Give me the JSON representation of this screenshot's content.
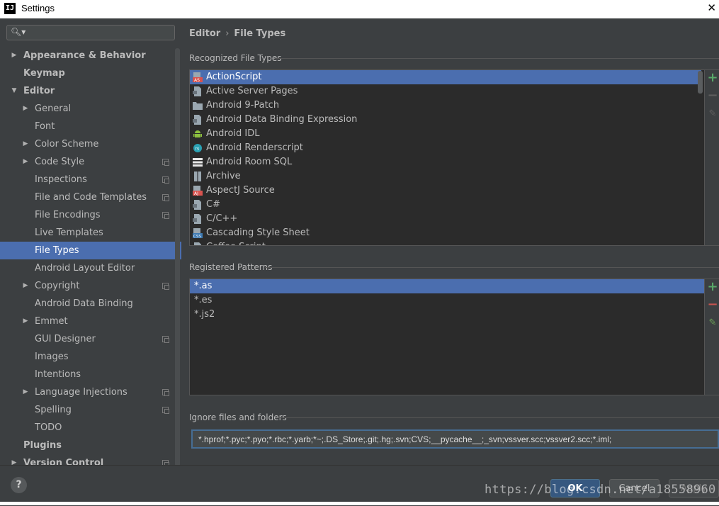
{
  "window": {
    "title": "Settings",
    "app_icon": "IJ"
  },
  "search": {
    "placeholder": "",
    "value": ""
  },
  "sidebar": {
    "items": [
      {
        "label": "Appearance & Behavior",
        "level": 0,
        "arrow": "right",
        "bold": true,
        "project": false,
        "selected": false
      },
      {
        "label": "Keymap",
        "level": 0,
        "arrow": "none",
        "bold": true,
        "project": false,
        "selected": false
      },
      {
        "label": "Editor",
        "level": 0,
        "arrow": "down",
        "bold": true,
        "project": false,
        "selected": false
      },
      {
        "label": "General",
        "level": 1,
        "arrow": "right",
        "bold": false,
        "project": false,
        "selected": false
      },
      {
        "label": "Font",
        "level": 1,
        "arrow": "none",
        "bold": false,
        "project": false,
        "selected": false
      },
      {
        "label": "Color Scheme",
        "level": 1,
        "arrow": "right",
        "bold": false,
        "project": false,
        "selected": false
      },
      {
        "label": "Code Style",
        "level": 1,
        "arrow": "right",
        "bold": false,
        "project": true,
        "selected": false
      },
      {
        "label": "Inspections",
        "level": 1,
        "arrow": "none",
        "bold": false,
        "project": true,
        "selected": false
      },
      {
        "label": "File and Code Templates",
        "level": 1,
        "arrow": "none",
        "bold": false,
        "project": true,
        "selected": false
      },
      {
        "label": "File Encodings",
        "level": 1,
        "arrow": "none",
        "bold": false,
        "project": true,
        "selected": false
      },
      {
        "label": "Live Templates",
        "level": 1,
        "arrow": "none",
        "bold": false,
        "project": false,
        "selected": false
      },
      {
        "label": "File Types",
        "level": 1,
        "arrow": "none",
        "bold": false,
        "project": false,
        "selected": true
      },
      {
        "label": "Android Layout Editor",
        "level": 1,
        "arrow": "none",
        "bold": false,
        "project": false,
        "selected": false
      },
      {
        "label": "Copyright",
        "level": 1,
        "arrow": "right",
        "bold": false,
        "project": true,
        "selected": false
      },
      {
        "label": "Android Data Binding",
        "level": 1,
        "arrow": "none",
        "bold": false,
        "project": false,
        "selected": false
      },
      {
        "label": "Emmet",
        "level": 1,
        "arrow": "right",
        "bold": false,
        "project": false,
        "selected": false
      },
      {
        "label": "GUI Designer",
        "level": 1,
        "arrow": "none",
        "bold": false,
        "project": true,
        "selected": false
      },
      {
        "label": "Images",
        "level": 1,
        "arrow": "none",
        "bold": false,
        "project": false,
        "selected": false
      },
      {
        "label": "Intentions",
        "level": 1,
        "arrow": "none",
        "bold": false,
        "project": false,
        "selected": false
      },
      {
        "label": "Language Injections",
        "level": 1,
        "arrow": "right",
        "bold": false,
        "project": true,
        "selected": false
      },
      {
        "label": "Spelling",
        "level": 1,
        "arrow": "none",
        "bold": false,
        "project": true,
        "selected": false
      },
      {
        "label": "TODO",
        "level": 1,
        "arrow": "none",
        "bold": false,
        "project": false,
        "selected": false
      },
      {
        "label": "Plugins",
        "level": 0,
        "arrow": "none",
        "bold": true,
        "project": false,
        "selected": false
      },
      {
        "label": "Version Control",
        "level": 0,
        "arrow": "right",
        "bold": true,
        "project": true,
        "selected": false
      }
    ]
  },
  "breadcrumb": {
    "parent": "Editor",
    "separator": "›",
    "current": "File Types"
  },
  "recognized": {
    "title": "Recognized File Types",
    "items": [
      {
        "label": "ActionScript",
        "icon": "actionscript-icon",
        "selected": true
      },
      {
        "label": "Active Server Pages",
        "icon": "document-icon",
        "selected": false
      },
      {
        "label": "Android 9-Patch",
        "icon": "folder-icon",
        "selected": false
      },
      {
        "label": "Android Data Binding Expression",
        "icon": "document-icon",
        "selected": false
      },
      {
        "label": "Android IDL",
        "icon": "android-icon",
        "selected": false
      },
      {
        "label": "Android Renderscript",
        "icon": "renderscript-icon",
        "selected": false
      },
      {
        "label": "Android Room SQL",
        "icon": "sql-icon",
        "selected": false
      },
      {
        "label": "Archive",
        "icon": "archive-icon",
        "selected": false
      },
      {
        "label": "AspectJ Source",
        "icon": "aspectj-icon",
        "selected": false
      },
      {
        "label": "C#",
        "icon": "document-icon",
        "selected": false
      },
      {
        "label": "C/C++",
        "icon": "document-icon",
        "selected": false
      },
      {
        "label": "Cascading Style Sheet",
        "icon": "css-icon",
        "selected": false
      },
      {
        "label": "Coffee Script",
        "icon": "document-icon",
        "selected": false
      }
    ]
  },
  "patterns": {
    "title": "Registered Patterns",
    "items": [
      {
        "label": "*.as",
        "selected": true
      },
      {
        "label": "*.es",
        "selected": false
      },
      {
        "label": "*.js2",
        "selected": false
      }
    ]
  },
  "ignore": {
    "title": "Ignore files and folders",
    "value": "*.hprof;*.pyc;*.pyo;*.rbc;*.yarb;*~;.DS_Store;.git;.hg;.svn;CVS;__pycache__;_svn;vssver.scc;vssver2.scc;*.iml;"
  },
  "buttons": {
    "ok": "OK",
    "cancel": "Cancel",
    "apply": "Apply",
    "help": "?"
  },
  "watermark": "https://blog.csdn.net/a18558960",
  "colors": {
    "selection": "#4b6eaf",
    "add": "#59a869",
    "remove": "#c75450",
    "background": "#3c3f41",
    "list_background": "#2b2b2b"
  }
}
